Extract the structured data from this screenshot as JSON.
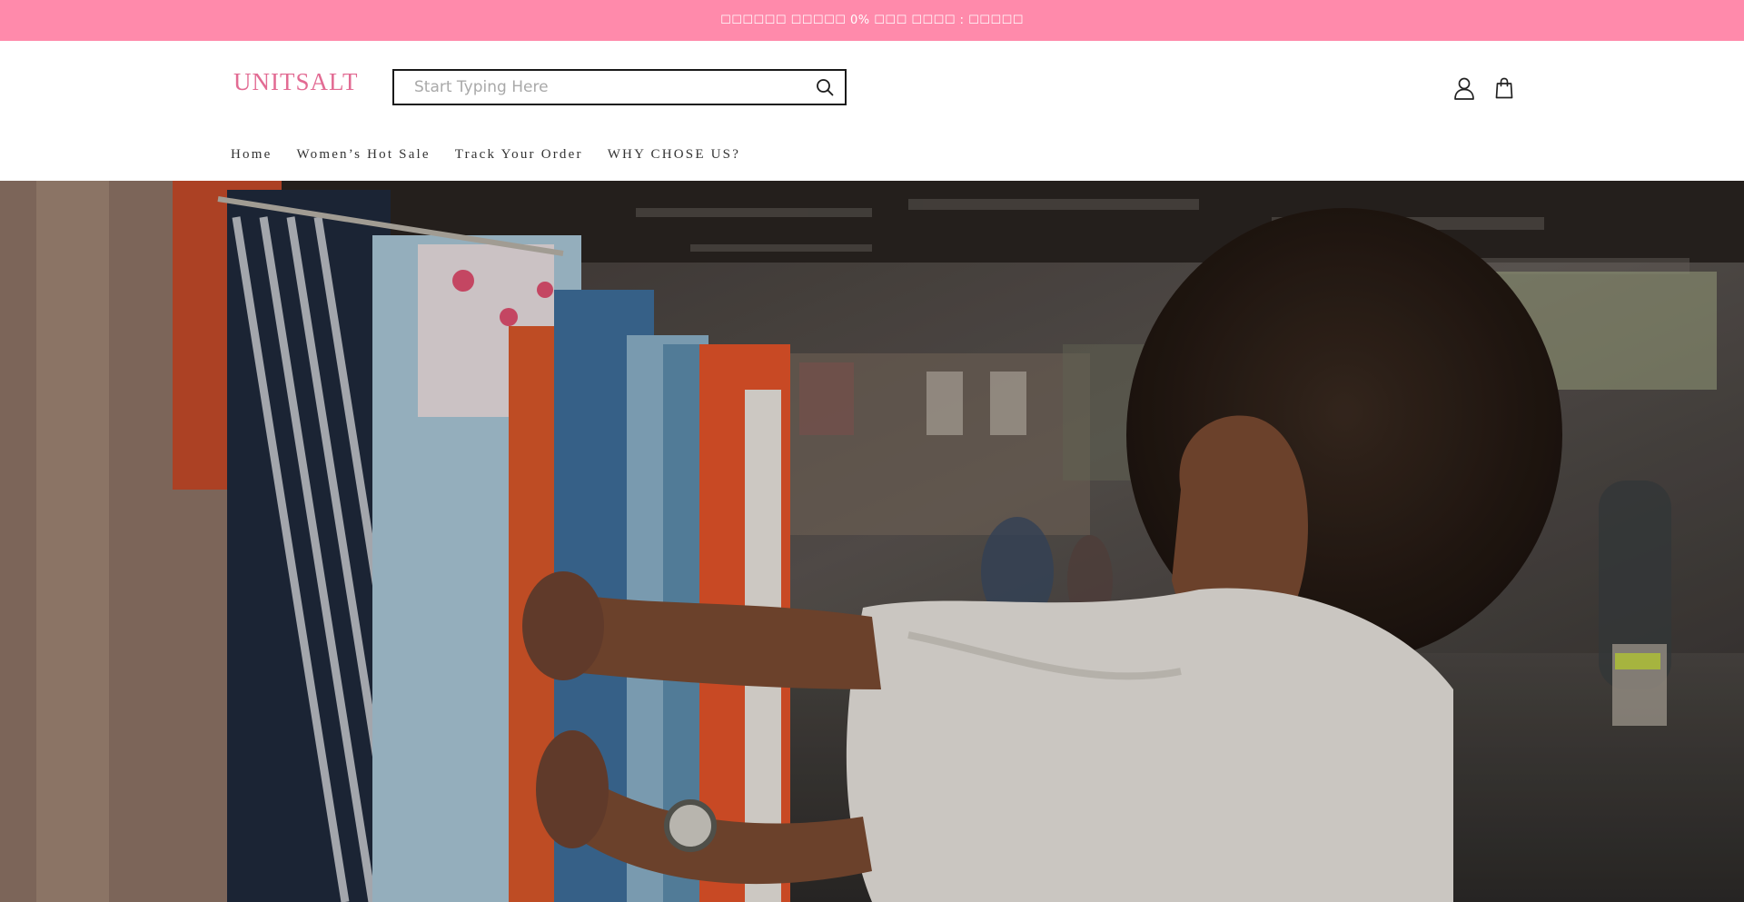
{
  "announcement": {
    "text": "☐☐☐☐☐☐ ☐☐☐☐☐ 0% ☐☐☐ ☐☐☐☐ : ☐☐☐☐☐"
  },
  "header": {
    "logo": "UNITSALT",
    "search": {
      "placeholder": "Start Typing Here",
      "value": "",
      "icon": "search-icon"
    },
    "icons": {
      "account": "user-icon",
      "cart": "shopping-bag-icon"
    }
  },
  "nav": {
    "items": [
      {
        "label": "Home"
      },
      {
        "label": "Women’s Hot Sale"
      },
      {
        "label": "Track Your Order"
      },
      {
        "label": "WHY CHOSE US?"
      }
    ]
  },
  "colors": {
    "announcement_bg": "#ff8aab",
    "logo": "#e26b93",
    "text": "#333333"
  }
}
